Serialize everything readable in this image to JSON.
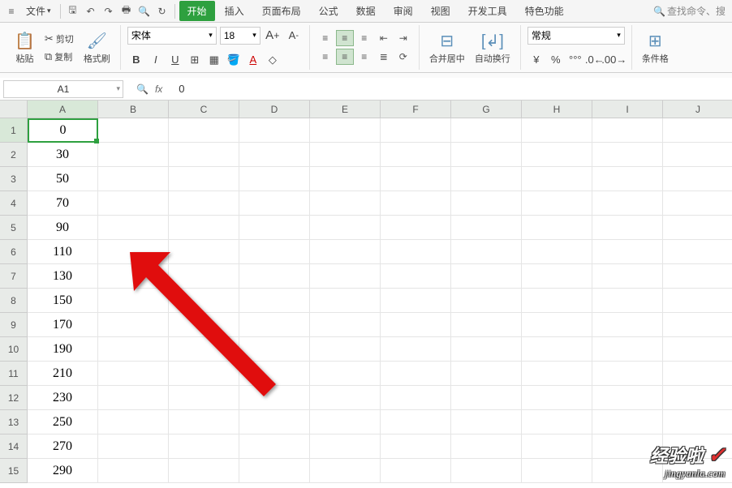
{
  "menubar": {
    "file_label": "文件",
    "tab_active": "开始",
    "tabs": [
      "插入",
      "页面布局",
      "公式",
      "数据",
      "审阅",
      "视图",
      "开发工具",
      "特色功能"
    ],
    "search_placeholder": "查找命令、搜"
  },
  "ribbon": {
    "paste_label": "粘贴",
    "cut_label": "剪切",
    "copy_label": "复制",
    "painter_label": "格式刷",
    "font_name": "宋体",
    "font_size": "18",
    "merge_label": "合并居中",
    "wrap_label": "自动换行",
    "num_format": "常规",
    "cond_format_label": "条件格"
  },
  "formula_bar": {
    "cell_ref": "A1",
    "fx_value": "0"
  },
  "columns": [
    "A",
    "B",
    "C",
    "D",
    "E",
    "F",
    "G",
    "H",
    "I",
    "J"
  ],
  "rows": [
    "1",
    "2",
    "3",
    "4",
    "5",
    "6",
    "7",
    "8",
    "9",
    "10",
    "11",
    "12",
    "13",
    "14",
    "15"
  ],
  "active_col": 0,
  "active_row": 0,
  "cell_data": {
    "A": [
      "0",
      "30",
      "50",
      "70",
      "90",
      "110",
      "130",
      "150",
      "170",
      "190",
      "210",
      "230",
      "250",
      "270",
      "290"
    ]
  },
  "watermark": {
    "line1": "经验啦",
    "line2": "jingyanla.com"
  }
}
